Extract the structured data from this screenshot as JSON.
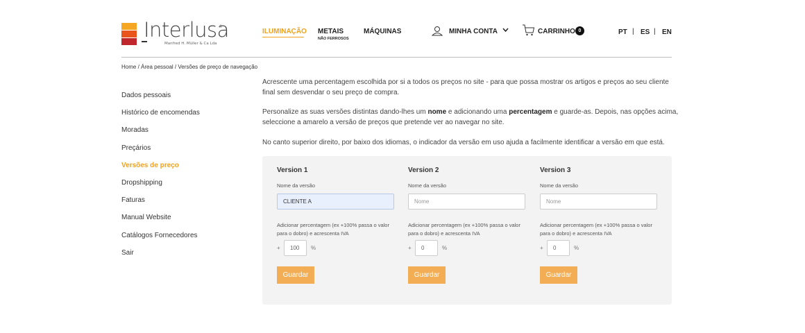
{
  "brand": {
    "name": "Interlusa",
    "reg": "®",
    "sub": "Manfred H. Müller & Ca Lda",
    "colors": [
      "#f5a623",
      "#e8541c",
      "#c0272d"
    ]
  },
  "nav": {
    "iluminacao": "ILUMINAÇÃO",
    "metais": "METAIS",
    "metais_sub": "NÃO FERROSOS",
    "maquinas": "MÁQUINAS",
    "account": "MINHA CONTA",
    "cart": "CARRINHO",
    "cart_count": "0",
    "accent": "#f2a11a"
  },
  "languages": {
    "pt": "PT",
    "es": "ES",
    "en": "EN",
    "sep": "|"
  },
  "breadcrumb": "Home / Área pessoal / Versões de preço de navegação",
  "sidebar": {
    "items": [
      {
        "label": "Dados pessoais"
      },
      {
        "label": "Histórico de encomendas"
      },
      {
        "label": "Moradas"
      },
      {
        "label": "Preçários"
      },
      {
        "label": "Versões de preço"
      },
      {
        "label": "Dropshipping"
      },
      {
        "label": "Faturas"
      },
      {
        "label": "Manual Website"
      },
      {
        "label": "Catálogos Fornecedores"
      },
      {
        "label": "Sair"
      }
    ]
  },
  "intro": {
    "p1": "Acrescente uma percentagem escolhida por si a todos os preços no site - para que possa mostrar os artigos e preços ao seu cliente final sem desvendar o seu preço de compra.",
    "p2_a": "Personalize as suas versões distintas dando-lhes um ",
    "p2_b": "nome",
    "p2_c": " e adicionando uma ",
    "p2_d": "percentagem",
    "p2_e": " e guarde-as. Depois, nas opções acima, seleccione a amarelo a versão de preços que pretende ver ao navegar no site.",
    "p3": "No canto superior direito, por baixo dos idiomas, o indicador da versão em uso ajuda a facilmente identificar a versão em que está."
  },
  "versions": [
    {
      "title": "Version 1",
      "name_label": "Nome da versão",
      "name_value": "CLIENTE A",
      "desc": "Adicionar percentagem (ex +100% passa o valor para o dobro) e acrescenta IVA",
      "plus": "+",
      "pct_value": "100",
      "pct_sign": "%",
      "save": "Guardar"
    },
    {
      "title": "Version 2",
      "name_label": "Nome da versão",
      "name_placeholder": "Nome",
      "desc": "Adicionar percentagem (ex +100% passa o valor para o dobro) e acrescenta IVA",
      "plus": "+",
      "pct_value": "0",
      "pct_sign": "%",
      "save": "Guardar"
    },
    {
      "title": "Version 3",
      "name_label": "Nome da versão",
      "name_placeholder": "Nome",
      "desc": "Adicionar percentagem (ex +100% passa o valor para o dobro) e acrescenta IVA",
      "plus": "+",
      "pct_value": "0",
      "pct_sign": "%",
      "save": "Guardar"
    }
  ]
}
